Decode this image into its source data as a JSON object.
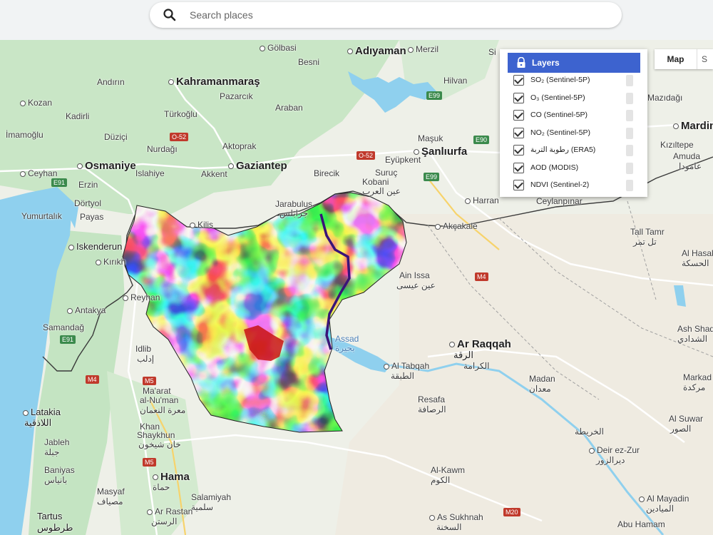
{
  "search": {
    "placeholder": "Search places"
  },
  "map_type": {
    "map_label": "Map",
    "satellite_label": "S"
  },
  "layers_panel": {
    "title": "Layers",
    "items": [
      {
        "label": "SO₂ (Sentinel-5P)",
        "checked": true
      },
      {
        "label": "O₃ (Sentinel-5P)",
        "checked": true
      },
      {
        "label": "CO (Sentinel-5P)",
        "checked": true
      },
      {
        "label": "NO₂ (Sentinel-5P)",
        "checked": true
      },
      {
        "label": "رطوبة التربة (ERA5)",
        "checked": true
      },
      {
        "label": "AOD (MODIS)",
        "checked": true
      },
      {
        "label": "NDVI (Sentinel-2)",
        "checked": true
      }
    ]
  },
  "overlay": {
    "colors": [
      "#0a2fb5",
      "#1f78e8",
      "#2fc6e6",
      "#58e08a",
      "#f3f03a",
      "#f5a623",
      "#e8441d",
      "#c81414"
    ]
  },
  "places": {
    "golbasi": "Gölbasi",
    "adiyaman": "Adıyaman",
    "merzil": "Merzil",
    "si": "Si",
    "besni": "Besni",
    "andirin": "Andırın",
    "kahramanmaras": "Kahramanmaraş",
    "hilvan": "Hilvan",
    "pazarcik": "Pazarcık",
    "mazidagi": "Mazıdağı",
    "kozan": "Kozan",
    "araban": "Araban",
    "kadirli": "Kadirli",
    "turkoglu": "Türkoğlu",
    "imamoglu": "İmamoğlu",
    "duzici": "Düziçi",
    "masuk": "Maşuk",
    "mardin": "Mardin",
    "nurdagi": "Nurdağı",
    "aktoprak": "Aktoprak",
    "sanliurfa": "Şanlıurfa",
    "kiziltepe": "Kızıltepe",
    "osmaniye": "Osmaniye",
    "eyupkent": "Eyüpkent",
    "amuda": "Amuda",
    "amuda_ar": "عامودا",
    "ceyhan": "Ceyhan",
    "islahiye": "Islahiye",
    "akkent": "Akkent",
    "gaziantep": "Gaziantep",
    "birecik": "Birecik",
    "suruc": "Suruç",
    "kobani": "Kobani",
    "kobani_ar": "عين العرب",
    "erzin": "Erzin",
    "harran": "Harran",
    "ceylanpinar": "Ceylanpınar",
    "dortyol": "Dörtyol",
    "jarabulus": "Jarabulus",
    "jarabulus_ar": "جرابلس",
    "yumurtalik": "Yumurtalık",
    "payas": "Payas",
    "kilis": "Kilis",
    "akcakale": "Akçakale",
    "tall_tamr": "Tall Tamr",
    "tall_tamr_ar": "تل تمر",
    "iskenderun": "Iskenderun",
    "al_hasakah": "Al Hasak",
    "al_hasakah_ar": "الحسكة",
    "kirikhan": "Kırıkh",
    "ain_issa": "Ain Issa",
    "ain_issa_ar": "عين عيسى",
    "reyhanli": "Reyhan",
    "antakya": "Antakya",
    "assad": "Assad",
    "assad_ar": "بحيرة",
    "ar_raqqah": "Ar Raqqah",
    "ar_raqqah_ar": "الرقة",
    "ash_shadadi": "Ash Shad",
    "ash_shadadi_ar": "الشدادي",
    "samandag": "Samandağ",
    "idlib": "Idlib",
    "idlib_ar": "إدلب",
    "al_karamah_ar": "الكرامة",
    "al_tabqah": "Al Tabqah",
    "al_tabqah_ar": "الطبقة",
    "madan": "Madan",
    "madan_ar": "معدان",
    "markada": "Markad",
    "markada_ar": "مركدة",
    "maarat": "Ma'arat",
    "maarat2": "al-Nu'man",
    "maarat_ar": "معرة النعمان",
    "resafa": "Resafa",
    "resafa_ar": "الرصافة",
    "latakia": "Latakia",
    "latakia_ar": "اللاذقية",
    "al_suwar": "Al Suwar",
    "al_suwar_ar": "الصور",
    "khan": "Khan",
    "shaykhun": "Shaykhun",
    "khan_ar": "خان شيخون",
    "al_kharita_ar": "الخريطة",
    "jableh": "Jableh",
    "jableh_ar": "جبلة",
    "deir": "Deir ez-Zur",
    "deir_ar": "ديرالزور",
    "baniyas": "Baniyas",
    "baniyas_ar": "بانياس",
    "hama": "Hama",
    "hama_ar": "حماة",
    "al_kawm": "Al-Kawm",
    "al_kawm_ar": "الكوم",
    "masyaf": "Masyaf",
    "masyaf_ar": "مصياف",
    "salamiyah": "Salamiyah",
    "salamiyah_ar": "سلمية",
    "al_mayadin": "Al Mayadin",
    "al_mayadin_ar": "الميادين",
    "tartus": "Tartus",
    "tartus_ar": "طرطوس",
    "ar_rastan": "Ar Rastan",
    "ar_rastan_ar": "الرستن",
    "as_sukhnah": "As Sukhnah",
    "as_sukhnah_ar": "السخنة",
    "abu_hamam": "Abu Hamam"
  },
  "road_shields": {
    "o52a": "O-52",
    "o52b": "O-52",
    "e99a": "E99",
    "e99b": "E99",
    "e90": "E90",
    "e91a": "E91",
    "e91b": "E91",
    "m4a": "M4",
    "m4b": "M4",
    "m5a": "M5",
    "m5b": "M5",
    "m20": "M20"
  }
}
